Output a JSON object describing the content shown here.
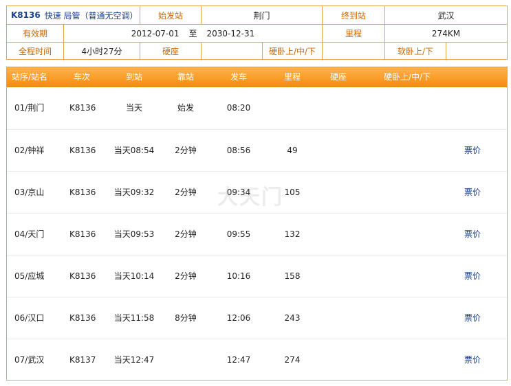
{
  "train": {
    "number": "K8136",
    "description": "快速  局管（普通无空调）"
  },
  "info": {
    "origin_label": "始发站",
    "origin_value": "荆门",
    "terminal_label": "终到站",
    "terminal_value": "武汉",
    "validity_label": "有效期",
    "validity_from": "2012-07-01",
    "validity_to_word": "至",
    "validity_to": "2030-12-31",
    "mileage_label": "里程",
    "mileage_value": "274KM",
    "duration_label": "全程时间",
    "duration_value": "4小时27分",
    "hard_seat_label": "硬座",
    "hard_seat_value": "",
    "hard_sleeper_label": "硬卧上/中/下",
    "hard_sleeper_value": "",
    "soft_sleeper_label": "软卧上/下",
    "soft_sleeper_value": ""
  },
  "table": {
    "headers": {
      "station": "站序/站名",
      "train": "车次",
      "arrive": "到站",
      "dwell": "靠站",
      "depart": "发车",
      "distance": "里程",
      "hard_seat": "硬座",
      "hard_sleeper": "硬卧上/中/下"
    },
    "rows": [
      {
        "station": "01/荆门",
        "train": "K8136",
        "arrive": "当天",
        "dwell": "始发",
        "depart": "08:20",
        "distance": "",
        "price": ""
      },
      {
        "station": "02/钟祥",
        "train": "K8136",
        "arrive": "当天08:54",
        "dwell": "2分钟",
        "depart": "08:56",
        "distance": "49",
        "price": "票价"
      },
      {
        "station": "03/京山",
        "train": "K8136",
        "arrive": "当天09:32",
        "dwell": "2分钟",
        "depart": "09:34",
        "distance": "105",
        "price": "票价"
      },
      {
        "station": "04/天门",
        "train": "K8136",
        "arrive": "当天09:53",
        "dwell": "2分钟",
        "depart": "09:55",
        "distance": "132",
        "price": "票价"
      },
      {
        "station": "05/应城",
        "train": "K8136",
        "arrive": "当天10:14",
        "dwell": "2分钟",
        "depart": "10:16",
        "distance": "158",
        "price": "票价"
      },
      {
        "station": "06/汉口",
        "train": "K8136",
        "arrive": "当天11:58",
        "dwell": "8分钟",
        "depart": "12:06",
        "distance": "243",
        "price": "票价"
      },
      {
        "station": "07/武汉",
        "train": "K8137",
        "arrive": "当天12:47",
        "dwell": "",
        "depart": "12:47",
        "distance": "274",
        "price": "票价"
      }
    ]
  },
  "watermark": "大天门"
}
